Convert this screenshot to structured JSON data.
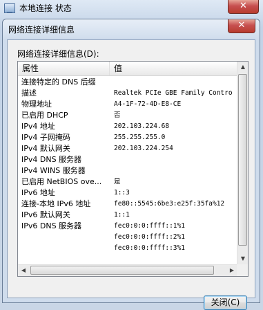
{
  "parent_window": {
    "title": "本地连接 状态",
    "close_glyph": "✕"
  },
  "dialog": {
    "title": "网络连接详细信息",
    "close_glyph": "✕",
    "details_label": "网络连接详细信息(D):",
    "columns": {
      "property": "属性",
      "value": "值"
    },
    "rows": [
      {
        "property": "连接特定的 DNS 后缀",
        "value": ""
      },
      {
        "property": "描述",
        "value": "Realtek PCIe GBE Family Contro"
      },
      {
        "property": "物理地址",
        "value": "A4-1F-72-4D-E8-CE"
      },
      {
        "property": "已启用 DHCP",
        "value": "否"
      },
      {
        "property": "IPv4 地址",
        "value": "202.103.224.68"
      },
      {
        "property": "IPv4 子网掩码",
        "value": "255.255.255.0"
      },
      {
        "property": "IPv4 默认网关",
        "value": "202.103.224.254"
      },
      {
        "property": "IPv4 DNS 服务器",
        "value": ""
      },
      {
        "property": "IPv4 WINS 服务器",
        "value": ""
      },
      {
        "property": "已启用 NetBIOS ove...",
        "value": "是"
      },
      {
        "property": "IPv6 地址",
        "value": "1::3"
      },
      {
        "property": "连接-本地 IPv6 地址",
        "value": "fe80::5545:6be3:e25f:35fa%12"
      },
      {
        "property": "IPv6 默认网关",
        "value": "1::1"
      },
      {
        "property": "IPv6 DNS 服务器",
        "value": "fec0:0:0:ffff::1%1"
      },
      {
        "property": "",
        "value": "fec0:0:0:ffff::2%1"
      },
      {
        "property": "",
        "value": "fec0:0:0:ffff::3%1"
      }
    ],
    "scroll_glyphs": {
      "up": "▲",
      "down": "▼",
      "left": "◀",
      "right": "▶"
    },
    "close_button_label": "关闭(C)"
  }
}
